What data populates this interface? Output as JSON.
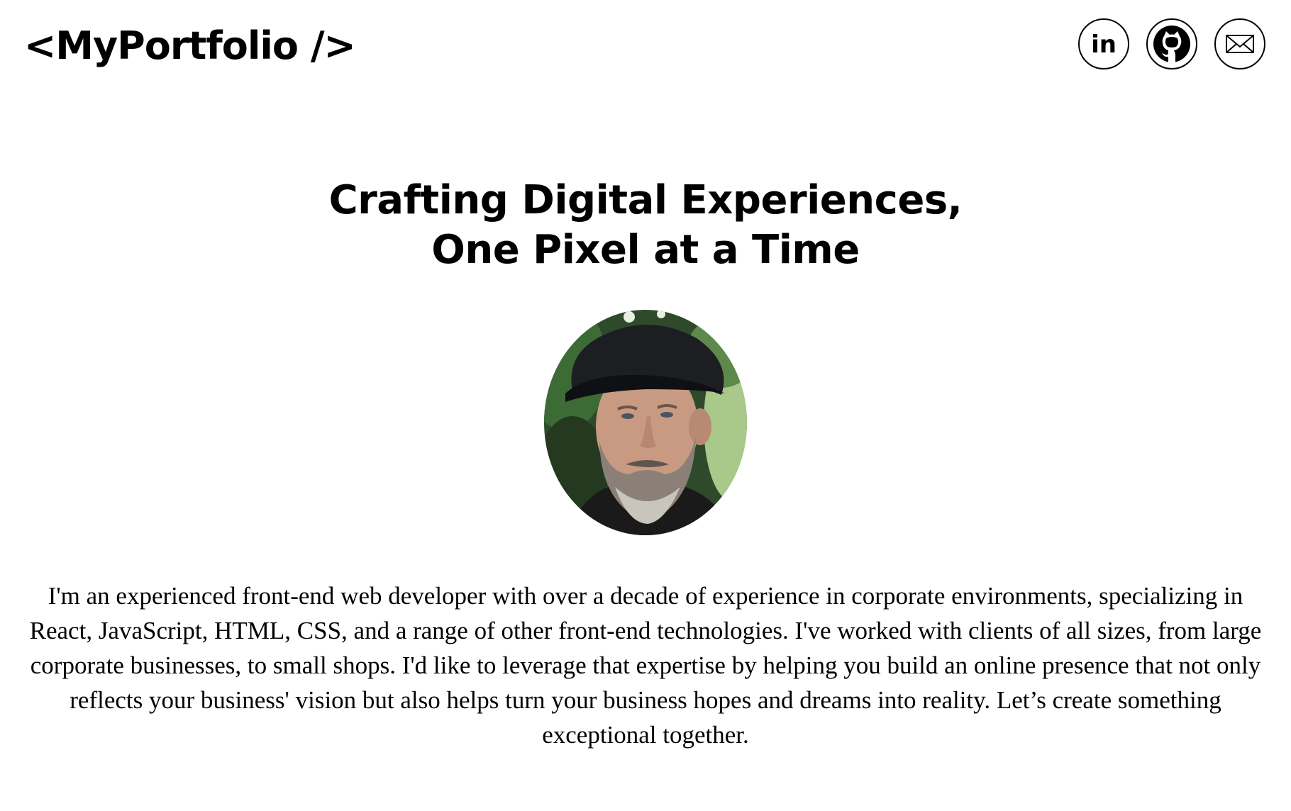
{
  "header": {
    "logo": "<MyPortfolio />",
    "social": {
      "linkedin_label": "in"
    }
  },
  "hero": {
    "title_line1": "Crafting Digital Experiences,",
    "title_line2": "One Pixel at a Time"
  },
  "icons": {
    "linkedin": "linkedin-icon",
    "github": "github-icon",
    "email": "envelope-icon"
  },
  "bio": "I'm an experienced front-end web developer with over a decade of experience in corporate environments, specializing in React, JavaScript, HTML, CSS, and a range of other front-end technologies. I've worked with clients of all sizes, from large corporate businesses, to small shops. I'd like to leverage that expertise by helping you build an online presence that not only reflects your business' vision but also helps turn your business hopes and dreams into reality. Let’s create something exceptional together."
}
